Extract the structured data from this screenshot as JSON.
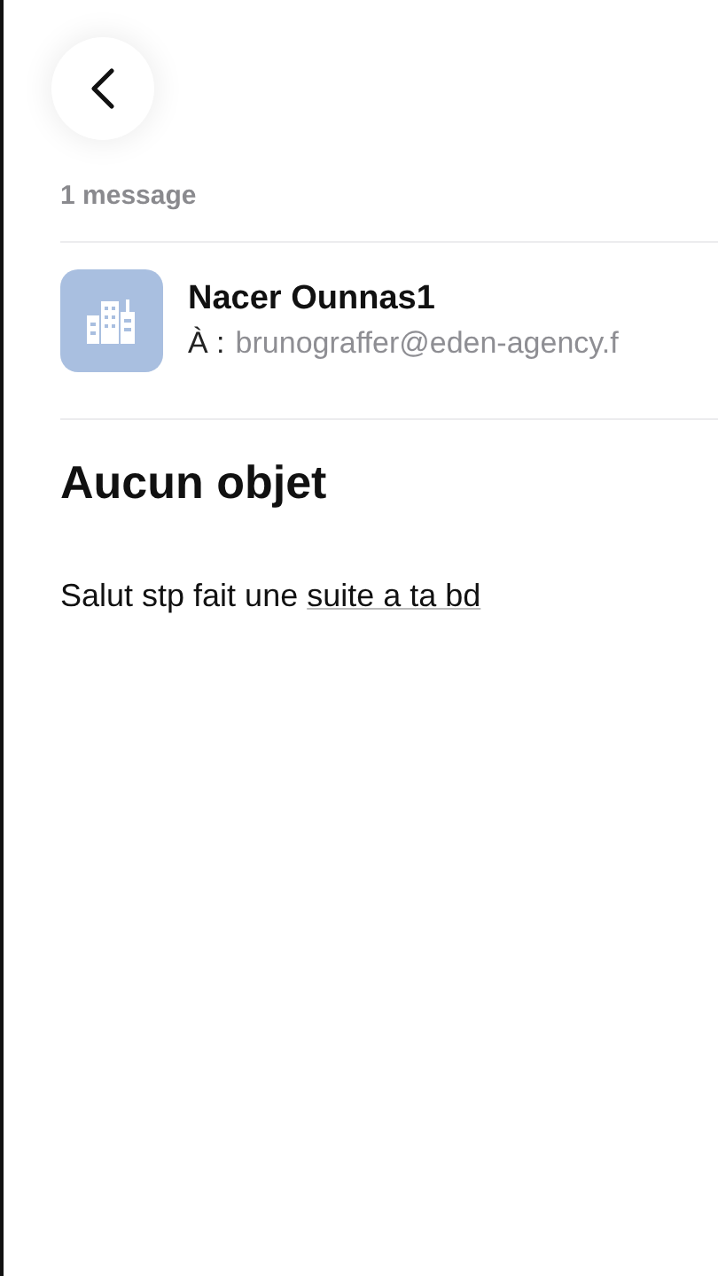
{
  "thread": {
    "count": "1 message"
  },
  "message": {
    "sender": "Nacer Ounnas1",
    "to_label": "À :",
    "to": "brunograffer@eden-agency.f",
    "subject": "Aucun objet",
    "body": {
      "text": "Salut stp fait une",
      "link": "suite a ta bd"
    }
  }
}
